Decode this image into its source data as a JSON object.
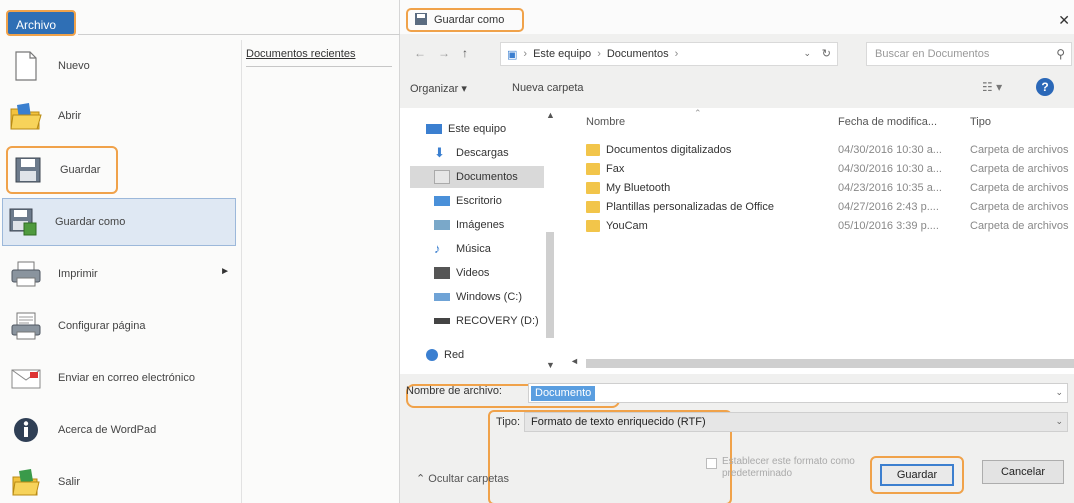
{
  "menu": {
    "archivo_tab": "Archivo",
    "items": [
      {
        "label": "Nuevo",
        "icon": "new-document-icon"
      },
      {
        "label": "Abrir",
        "icon": "open-folder-icon"
      },
      {
        "label": "Guardar",
        "icon": "floppy-disk-icon"
      },
      {
        "label": "Guardar como",
        "icon": "save-as-icon"
      },
      {
        "label": "Imprimir",
        "icon": "printer-icon",
        "has_submenu": true
      },
      {
        "label": "Configurar página",
        "icon": "page-setup-icon"
      },
      {
        "label": "Enviar en correo electrónico",
        "icon": "email-icon"
      },
      {
        "label": "Acerca de WordPad",
        "icon": "info-icon"
      },
      {
        "label": "Salir",
        "icon": "exit-icon"
      }
    ],
    "recent_header": "Documentos recientes"
  },
  "dialog": {
    "title": "Guardar como",
    "address": {
      "segments": [
        "Este equipo",
        "Documentos"
      ]
    },
    "search_placeholder": "Buscar en Documentos",
    "toolbar": {
      "organize": "Organizar ▾",
      "new_folder": "Nueva carpeta"
    },
    "nav_items": [
      {
        "label": "Este equipo",
        "icon": "computer-icon"
      },
      {
        "label": "Descargas",
        "icon": "downloads-icon"
      },
      {
        "label": "Documentos",
        "icon": "documents-icon",
        "selected": true
      },
      {
        "label": "Escritorio",
        "icon": "desktop-icon"
      },
      {
        "label": "Imágenes",
        "icon": "pictures-icon"
      },
      {
        "label": "Música",
        "icon": "music-icon"
      },
      {
        "label": "Videos",
        "icon": "videos-icon"
      },
      {
        "label": "Windows (C:)",
        "icon": "drive-icon"
      },
      {
        "label": "RECOVERY (D:)",
        "icon": "drive-icon"
      },
      {
        "label": "Red",
        "icon": "network-icon"
      }
    ],
    "columns": {
      "name": "Nombre",
      "date": "Fecha de modifica...",
      "type": "Tipo"
    },
    "files": [
      {
        "name": "Documentos digitalizados",
        "date": "04/30/2016 10:30 a...",
        "type": "Carpeta de archivos"
      },
      {
        "name": "Fax",
        "date": "04/30/2016 10:30 a...",
        "type": "Carpeta de archivos"
      },
      {
        "name": "My Bluetooth",
        "date": "04/23/2016 10:35 a...",
        "type": "Carpeta de archivos"
      },
      {
        "name": "Plantillas personalizadas de Office",
        "date": "04/27/2016 2:43 p....",
        "type": "Carpeta de archivos"
      },
      {
        "name": "YouCam",
        "date": "05/10/2016 3:39 p....",
        "type": "Carpeta de archivos"
      }
    ],
    "filename_label": "Nombre de archivo:",
    "filename_value": "Documento",
    "type_label": "Tipo:",
    "type_value": "Formato de texto enriquecido (RTF)",
    "hide_folders": "Ocultar carpetas",
    "default_format_label": "Establecer este formato como predeterminado",
    "save_button": "Guardar",
    "cancel_button": "Cancelar"
  }
}
